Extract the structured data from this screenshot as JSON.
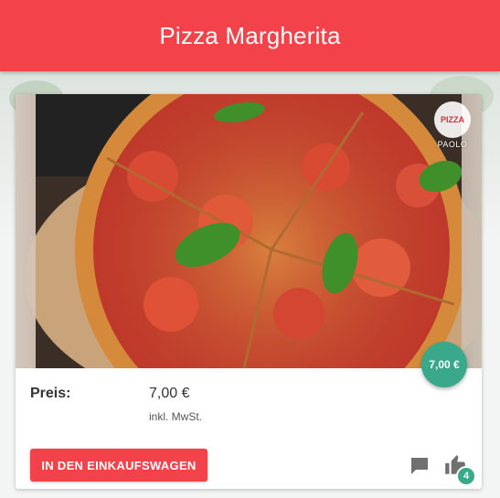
{
  "header": {
    "title": "Pizza Margherita"
  },
  "product": {
    "image_alt": "Pizza Margherita",
    "logo": {
      "mark": "PIZZA",
      "text": "PAOLO"
    },
    "price_badge": "7,00 €",
    "price_label": "Preis:",
    "price_value": "7,00 €",
    "tax_note": "inkl. MwSt.",
    "add_to_cart_label": "IN DEN EINKAUFSWAGEN",
    "likes_count": "4"
  },
  "colors": {
    "primary": "#f4424a",
    "accent": "#3aa88a"
  },
  "icons": {
    "comment": "comment-icon",
    "like": "thumb-up-icon"
  }
}
